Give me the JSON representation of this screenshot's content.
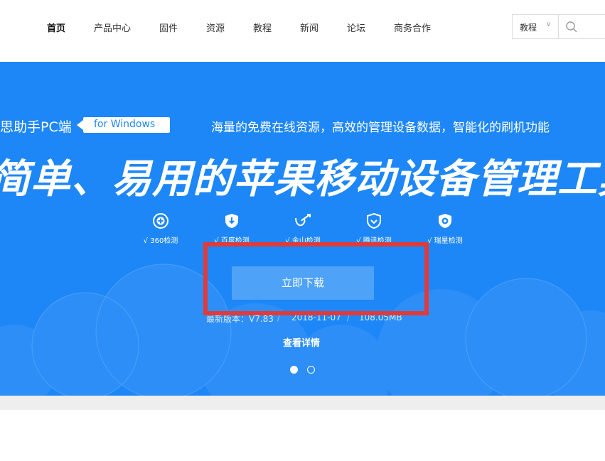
{
  "nav": {
    "items": [
      {
        "label": "首页",
        "active": true
      },
      {
        "label": "产品中心"
      },
      {
        "label": "固件"
      },
      {
        "label": "资源"
      },
      {
        "label": "教程"
      },
      {
        "label": "新闻"
      },
      {
        "label": "论坛"
      },
      {
        "label": "商务合作"
      }
    ]
  },
  "search": {
    "category": "教程",
    "icon": "search-icon"
  },
  "banner": {
    "product_suffix": "思助手PC端",
    "platform_tag": "for Windows",
    "tagline": "海量的免费在线资源，高效的管理设备数据，智能化的刷机功能",
    "headline": "简单、易用的苹果移动设备管理工具",
    "features": [
      {
        "label": "√ 360检测",
        "icon": "360-shield-icon"
      },
      {
        "label": "√ 百度检测",
        "icon": "baidu-shield-icon"
      },
      {
        "label": "√ 金山检测",
        "icon": "kingsoft-icon"
      },
      {
        "label": "√ 腾讯检测",
        "icon": "tencent-shield-icon"
      },
      {
        "label": "√ 瑞星检测",
        "icon": "rising-lion-icon"
      }
    ],
    "download_label": "立即下载",
    "version": "最新版本：V7.83",
    "date": "2018-11-07",
    "size": "108.05MB",
    "details_label": "查看详情",
    "carousel_dots": 2,
    "carousel_active": 0,
    "colors": {
      "banner_bg": "#1e87f7",
      "button_bg": "#4ea2f8",
      "highlight_border": "#e03a3a"
    }
  }
}
